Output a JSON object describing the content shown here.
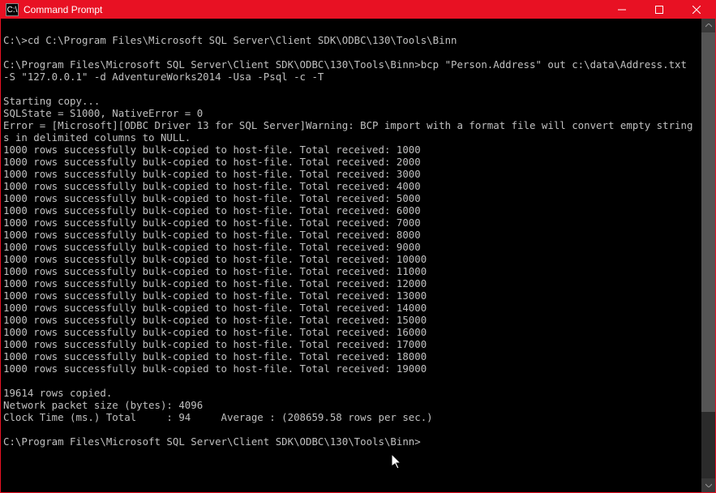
{
  "titlebar": {
    "icon_label": "C:\\",
    "title": "Command Prompt"
  },
  "terminal": {
    "lines": [
      "",
      "C:\\>cd C:\\Program Files\\Microsoft SQL Server\\Client SDK\\ODBC\\130\\Tools\\Binn",
      "",
      "C:\\Program Files\\Microsoft SQL Server\\Client SDK\\ODBC\\130\\Tools\\Binn>bcp \"Person.Address\" out c:\\data\\Address.txt -S \"127.0.0.1\" -d AdventureWorks2014 -Usa -Psql -c -T",
      "",
      "Starting copy...",
      "SQLState = S1000, NativeError = 0",
      "Error = [Microsoft][ODBC Driver 13 for SQL Server]Warning: BCP import with a format file will convert empty strings in delimited columns to NULL.",
      "1000 rows successfully bulk-copied to host-file. Total received: 1000",
      "1000 rows successfully bulk-copied to host-file. Total received: 2000",
      "1000 rows successfully bulk-copied to host-file. Total received: 3000",
      "1000 rows successfully bulk-copied to host-file. Total received: 4000",
      "1000 rows successfully bulk-copied to host-file. Total received: 5000",
      "1000 rows successfully bulk-copied to host-file. Total received: 6000",
      "1000 rows successfully bulk-copied to host-file. Total received: 7000",
      "1000 rows successfully bulk-copied to host-file. Total received: 8000",
      "1000 rows successfully bulk-copied to host-file. Total received: 9000",
      "1000 rows successfully bulk-copied to host-file. Total received: 10000",
      "1000 rows successfully bulk-copied to host-file. Total received: 11000",
      "1000 rows successfully bulk-copied to host-file. Total received: 12000",
      "1000 rows successfully bulk-copied to host-file. Total received: 13000",
      "1000 rows successfully bulk-copied to host-file. Total received: 14000",
      "1000 rows successfully bulk-copied to host-file. Total received: 15000",
      "1000 rows successfully bulk-copied to host-file. Total received: 16000",
      "1000 rows successfully bulk-copied to host-file. Total received: 17000",
      "1000 rows successfully bulk-copied to host-file. Total received: 18000",
      "1000 rows successfully bulk-copied to host-file. Total received: 19000",
      "",
      "19614 rows copied.",
      "Network packet size (bytes): 4096",
      "Clock Time (ms.) Total     : 94     Average : (208659.58 rows per sec.)",
      "",
      "C:\\Program Files\\Microsoft SQL Server\\Client SDK\\ODBC\\130\\Tools\\Binn>"
    ]
  }
}
